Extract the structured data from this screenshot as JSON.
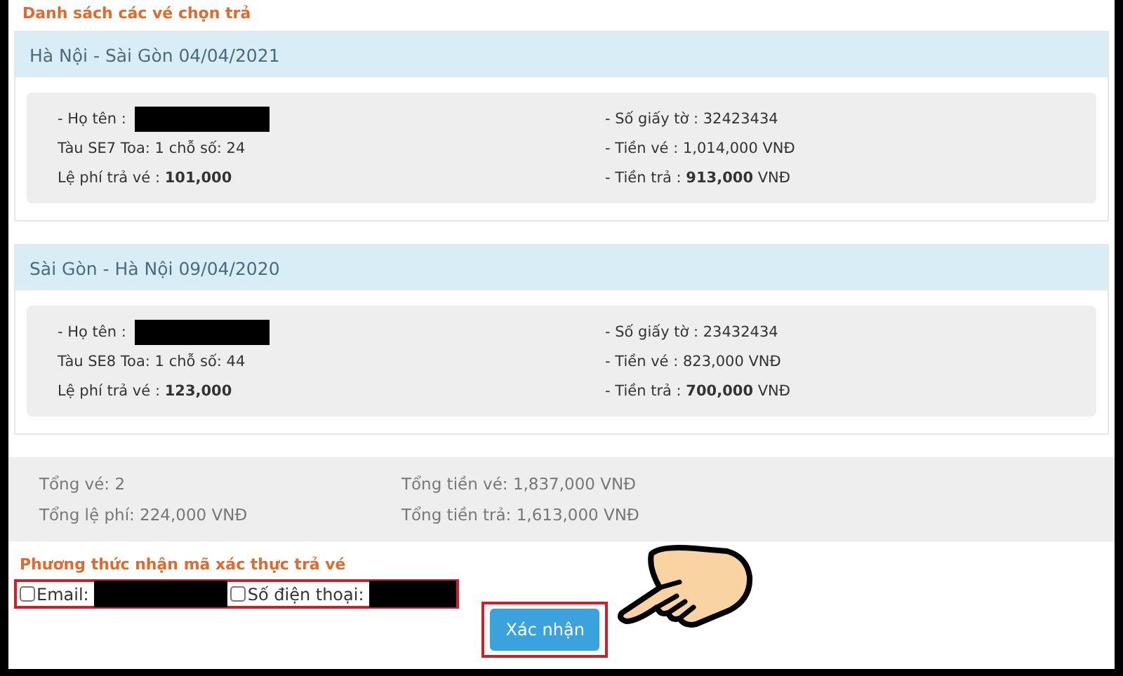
{
  "list_title": "Danh sách các vé chọn trả",
  "tickets": [
    {
      "route": "Hà Nội - Sài Gòn 04/04/2021",
      "name_label": "- Họ tên :",
      "train": "Tàu SE7 Toa: 1 chỗ số: 24",
      "fee": "Lệ phí trả vé : **101,000**",
      "id_doc": "- Số giấy tờ : 32423434",
      "price": "- Tiền vé : 1,014,000 VNĐ",
      "refund": "- Tiền trả : **913,000** VNĐ"
    },
    {
      "route": "Sài Gòn - Hà Nội 09/04/2020",
      "name_label": "- Họ tên :",
      "train": "Tàu SE8 Toa: 1 chỗ số: 44",
      "fee": "Lệ phí trả vé : **123,000**",
      "id_doc": "- Số giấy tờ : 23432434",
      "price": "- Tiền vé : 823,000 VNĐ",
      "refund": "- Tiền trả : **700,000** VNĐ"
    }
  ],
  "summary": {
    "total_tickets": "Tổng vé: 2",
    "total_price": "Tổng tiền vé: 1,837,000 VNĐ",
    "total_fee": "Tổng lệ phí: 224,000 VNĐ",
    "total_refund": "Tổng tiền trả: 1,613,000 VNĐ"
  },
  "method": {
    "title": "Phương thức nhận mã xác thực trả vé",
    "options": [
      {
        "label": "Email:",
        "checked": false
      },
      {
        "label": "Số điện thoại:",
        "checked": false
      }
    ]
  },
  "confirm_button": "Xác nhận"
}
